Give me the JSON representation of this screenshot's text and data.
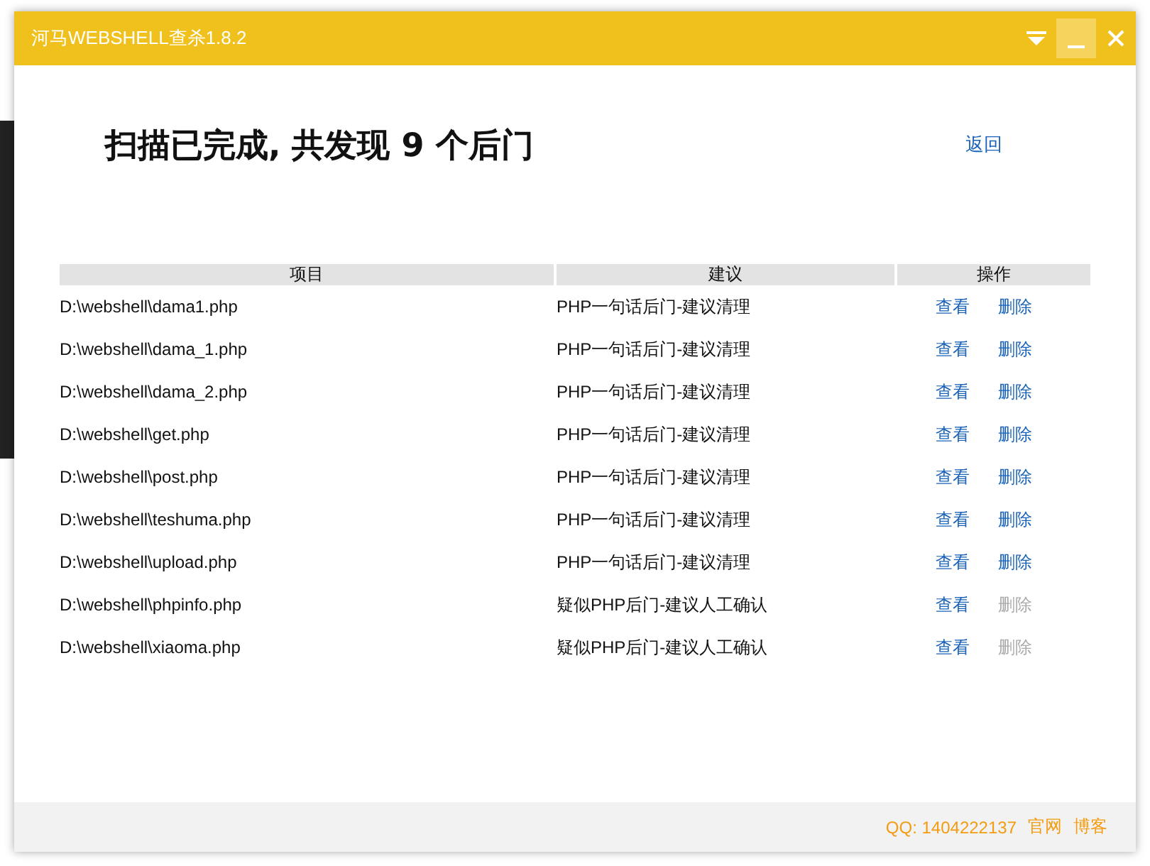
{
  "window": {
    "title": "河马WEBSHELL查杀1.8.2"
  },
  "heading": {
    "before": "扫描已完成, 共发现 ",
    "count": "9",
    "after": " 个后门"
  },
  "back_link": "返回",
  "table": {
    "columns": [
      "项目",
      "建议",
      "操作"
    ],
    "rows": [
      {
        "path": "D:\\webshell\\dama1.php",
        "advice": "PHP一句话后门-建议清理",
        "view": "查看",
        "delete": "删除",
        "delete_disabled": false
      },
      {
        "path": "D:\\webshell\\dama_1.php",
        "advice": "PHP一句话后门-建议清理",
        "view": "查看",
        "delete": "删除",
        "delete_disabled": false
      },
      {
        "path": "D:\\webshell\\dama_2.php",
        "advice": "PHP一句话后门-建议清理",
        "view": "查看",
        "delete": "删除",
        "delete_disabled": false
      },
      {
        "path": "D:\\webshell\\get.php",
        "advice": "PHP一句话后门-建议清理",
        "view": "查看",
        "delete": "删除",
        "delete_disabled": false
      },
      {
        "path": "D:\\webshell\\post.php",
        "advice": "PHP一句话后门-建议清理",
        "view": "查看",
        "delete": "删除",
        "delete_disabled": false
      },
      {
        "path": "D:\\webshell\\teshuma.php",
        "advice": "PHP一句话后门-建议清理",
        "view": "查看",
        "delete": "删除",
        "delete_disabled": false
      },
      {
        "path": "D:\\webshell\\upload.php",
        "advice": "PHP一句话后门-建议清理",
        "view": "查看",
        "delete": "删除",
        "delete_disabled": false
      },
      {
        "path": "D:\\webshell\\phpinfo.php",
        "advice": "疑似PHP后门-建议人工确认",
        "view": "查看",
        "delete": "删除",
        "delete_disabled": true
      },
      {
        "path": "D:\\webshell\\xiaoma.php",
        "advice": "疑似PHP后门-建议人工确认",
        "view": "查看",
        "delete": "删除",
        "delete_disabled": true
      }
    ]
  },
  "footer": {
    "qq": "QQ: 1404222137",
    "links": [
      "官网",
      "博客"
    ]
  }
}
